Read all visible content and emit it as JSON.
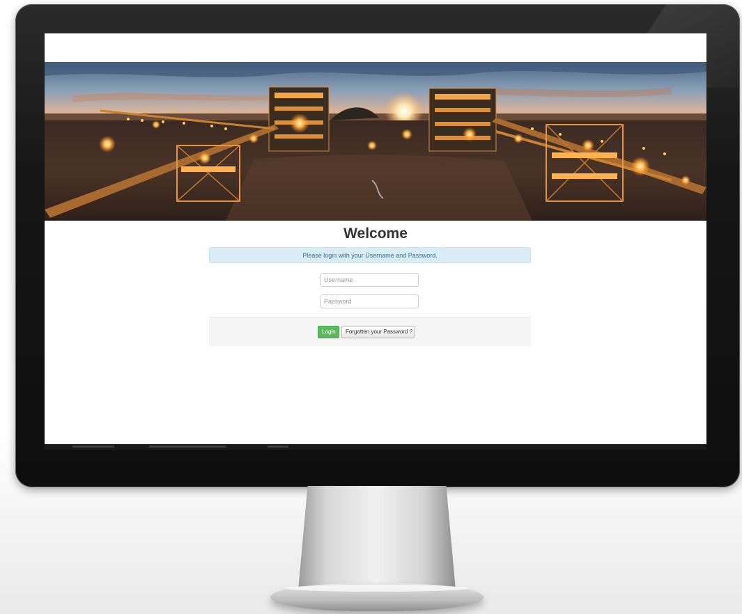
{
  "page": {
    "title": "Welcome",
    "info_message": "Please login with your Username and Password."
  },
  "form": {
    "username": {
      "value": "",
      "placeholder": "Username"
    },
    "password": {
      "value": "",
      "placeholder": "Password"
    }
  },
  "actions": {
    "login_label": "Login",
    "forgot_label": "Forgotten your Password ?"
  },
  "colors": {
    "alert_bg": "#d9edf7",
    "alert_text": "#31708f",
    "login_green": "#5cb85c",
    "footer_bg": "#f5f5f5"
  },
  "icons": {
    "hero": "mining-plant-night-photo"
  }
}
